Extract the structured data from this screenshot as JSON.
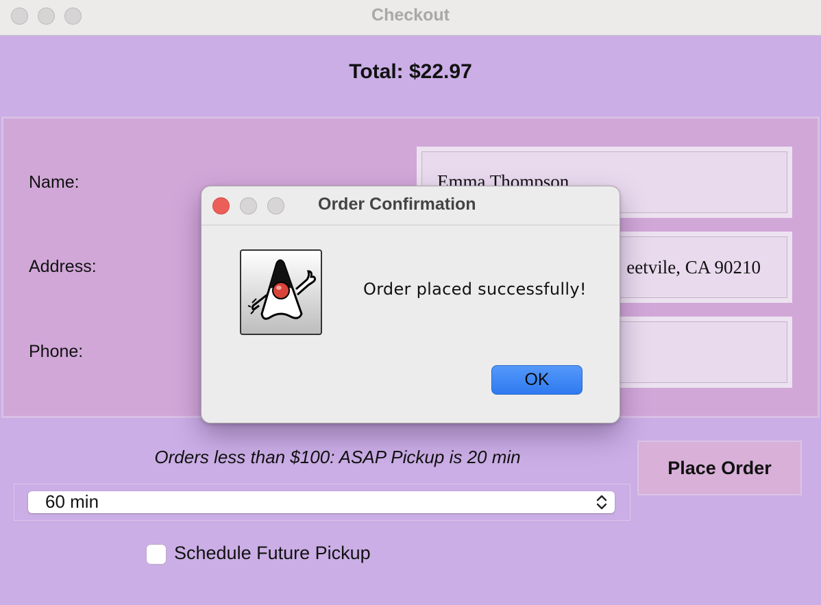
{
  "window": {
    "title": "Checkout"
  },
  "order": {
    "total_label": "Total: $22.97"
  },
  "form": {
    "fields": [
      {
        "label": "Name:",
        "value": "Emma Thompson"
      },
      {
        "label": "Address:",
        "value": "eetvile, CA 90210"
      },
      {
        "label": "Phone:",
        "value": ""
      }
    ]
  },
  "pickup": {
    "note": "Orders less than $100: ASAP Pickup is 20 min",
    "selected_time": "60 min",
    "schedule_label": "Schedule Future Pickup",
    "schedule_checked": false
  },
  "actions": {
    "place_order_label": "Place Order"
  },
  "dialog": {
    "title": "Order Confirmation",
    "message": "Order placed successfully!",
    "ok_label": "OK",
    "icon": "java-duke-icon"
  },
  "colors": {
    "window_bg": "#cbaee6",
    "form_bg": "#d1a7d8",
    "field_bg": "#e9daee",
    "button_bg": "#d8b0d8",
    "ok_button": "#3a84f6",
    "close_red": "#ec5f58"
  }
}
